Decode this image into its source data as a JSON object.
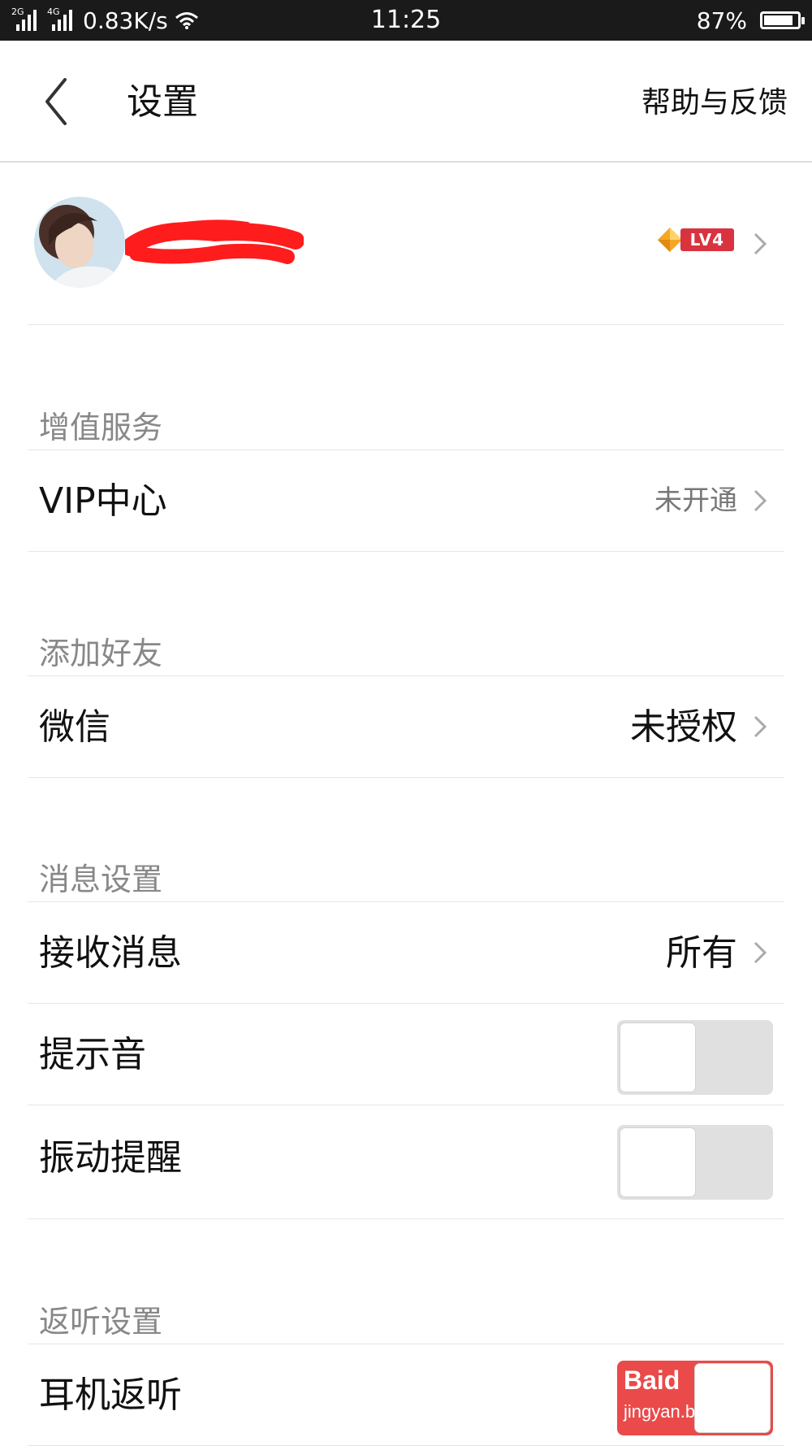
{
  "status_bar": {
    "sig1_tag": "2G",
    "sig2_tag": "4G",
    "net_speed": "0.83K/s",
    "time": "11:25",
    "battery_text": "87%",
    "battery_level": 0.87
  },
  "header": {
    "title": "设置",
    "help": "帮助与反馈"
  },
  "profile": {
    "level_badge": "LV4"
  },
  "sections": {
    "vas": {
      "title": "增值服务",
      "vip_label": "VIP中心",
      "vip_value": "未开通"
    },
    "friends": {
      "title": "添加好友",
      "wechat_label": "微信",
      "wechat_value": "未授权"
    },
    "messages": {
      "title": "消息设置",
      "receive_label": "接收消息",
      "receive_value": "所有",
      "sound_label": "提示音",
      "sound_on": false,
      "vibrate_label": "振动提醒",
      "vibrate_on": false
    },
    "monitor": {
      "title": "返听设置",
      "earphone_label": "耳机返听",
      "earphone_on": true
    }
  },
  "watermark": {
    "line1": "Baid",
    "line2": "jingyan.b"
  },
  "colors": {
    "accent_red": "#d9333f",
    "toggle_off": "#e0e0e0",
    "section_title": "#888888"
  }
}
